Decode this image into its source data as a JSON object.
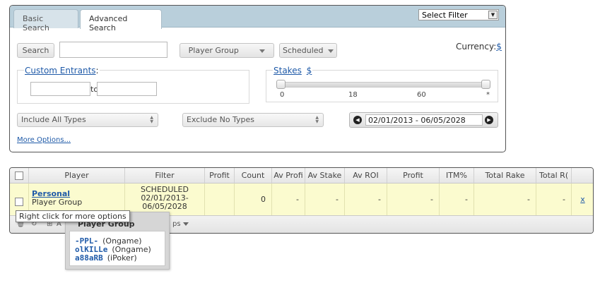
{
  "search_panel": {
    "tabs": [
      "Basic Search",
      "Advanced Search"
    ],
    "select_filter": "Select Filter",
    "search_button": "Search",
    "search_value": "",
    "player_group_button": "Player Group",
    "scheduled_button": "Scheduled",
    "currency_label": "Currency:",
    "currency_symbol": "$",
    "custom_entrants": {
      "label": "Custom Entrants",
      "colon": ":",
      "to_label": "to",
      "from_value": "",
      "to_value": ""
    },
    "stakes": {
      "label": "Stakes",
      "symbol": "$",
      "ticks": [
        "0",
        "18",
        "60",
        "*"
      ]
    },
    "include_types": "Include All Types",
    "exclude_types": "Exclude No Types",
    "date_range": "02/01/2013 - 06/05/2028",
    "more_options": "More Options..."
  },
  "grid": {
    "columns": [
      "Player",
      "Filter",
      "Profit",
      "Count",
      "Av Profi",
      "Av Stake",
      "Av ROI",
      "Profit",
      "ITM%",
      "Total Rake",
      "Total R("
    ],
    "row": {
      "player_name": "Personal",
      "player_type": "Player Group",
      "filter_lines": [
        "SCHEDULED",
        "02/01/2013-",
        "06/05/2028"
      ],
      "profit": "",
      "count": "0",
      "av_profit": "-",
      "av_stake": "-",
      "av_roi": "-",
      "profit2": "-",
      "itm": "-",
      "total_rake": "-",
      "total_rake2": "-",
      "remove": "x"
    },
    "footer_text_1": "A",
    "footer_text_2": "ps"
  },
  "tooltip": "Right click for more options",
  "popup": {
    "title": "Player Group",
    "members": [
      {
        "name": "-PPL-",
        "site": "(Ongame)"
      },
      {
        "name": "olKILLe",
        "site": "(Ongame)"
      },
      {
        "name": "a88aRB",
        "site": "(iPoker)"
      }
    ]
  },
  "colors": {
    "header_bg": "#b9cfdb",
    "row_highlight": "#fbfbcf",
    "link": "#1f5aa8"
  }
}
